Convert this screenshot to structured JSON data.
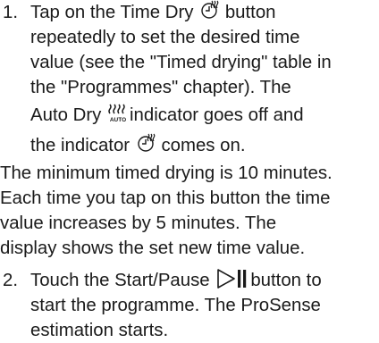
{
  "steps": [
    {
      "number": "1.",
      "text_a": "Tap on the Time Dry",
      "text_b": "button",
      "text_c": "repeatedly to set the desired time",
      "text_d": "value (see the \"Timed drying\" table in",
      "text_e": "the \"Programmes\" chapter). The",
      "text_f": "Auto Dry",
      "text_g": "indicator goes off and",
      "text_h": "the indicator",
      "text_i": "comes on."
    },
    {
      "number": "2.",
      "text_a": "Touch the Start/Pause",
      "text_b": "button to",
      "text_c": "start the programme. The ProSense",
      "text_d": "estimation starts."
    }
  ],
  "paragraph": {
    "line1": "The minimum timed drying is 10 minutes.",
    "line2": "Each time you tap on this button the time",
    "line3": "value increases by 5 minutes. The",
    "line4": "display shows the set new time value."
  },
  "icons": {
    "time_dry": "time-dry-icon",
    "auto_dry": "auto-dry-icon",
    "start_pause": "start-pause-icon",
    "auto_dry_label": "AUTO"
  }
}
